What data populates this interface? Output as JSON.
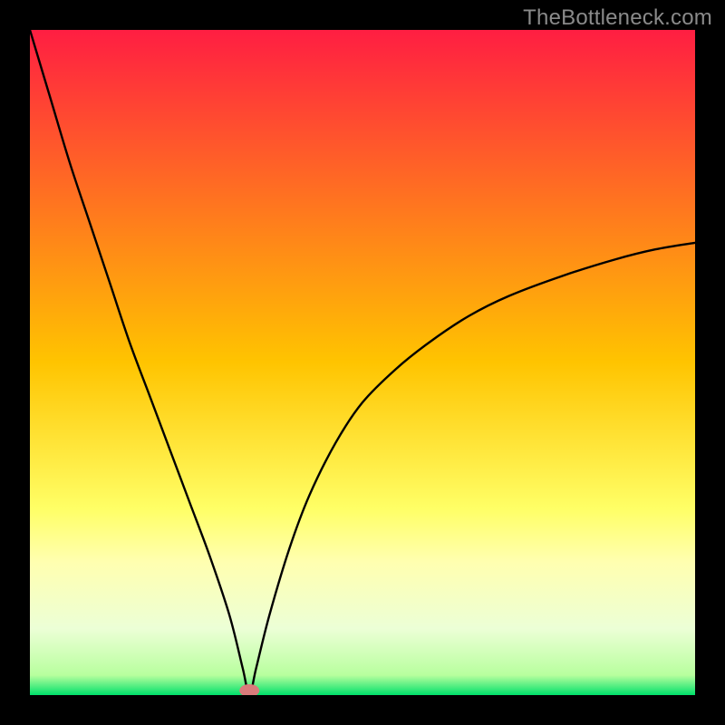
{
  "watermark": "TheBottleneck.com",
  "chart_data": {
    "type": "line",
    "title": "",
    "xlabel": "",
    "ylabel": "",
    "xlim": [
      0,
      100
    ],
    "ylim": [
      0,
      100
    ],
    "x_min_at": 33,
    "marker": {
      "x": 33,
      "y": 0,
      "color": "#d97b7b"
    },
    "gradient_stops": [
      {
        "pct": 0,
        "color": "#ff1e42"
      },
      {
        "pct": 50,
        "color": "#ffc400"
      },
      {
        "pct": 72,
        "color": "#ffff66"
      },
      {
        "pct": 80,
        "color": "#ffffb0"
      },
      {
        "pct": 90,
        "color": "#ecffd6"
      },
      {
        "pct": 97,
        "color": "#b8ff9e"
      },
      {
        "pct": 100,
        "color": "#00e06a"
      }
    ],
    "series": [
      {
        "name": "curve",
        "x": [
          0,
          3,
          6,
          9,
          12,
          15,
          18,
          21,
          24,
          27,
          30,
          32,
          33,
          34,
          36,
          39,
          42,
          46,
          50,
          55,
          60,
          66,
          72,
          80,
          88,
          94,
          100
        ],
        "values": [
          100,
          90,
          80,
          71,
          62,
          53,
          45,
          37,
          29,
          21,
          12,
          4,
          0,
          4,
          12,
          22,
          30,
          38,
          44,
          49,
          53,
          57,
          60,
          63,
          65.5,
          67,
          68
        ]
      }
    ]
  }
}
